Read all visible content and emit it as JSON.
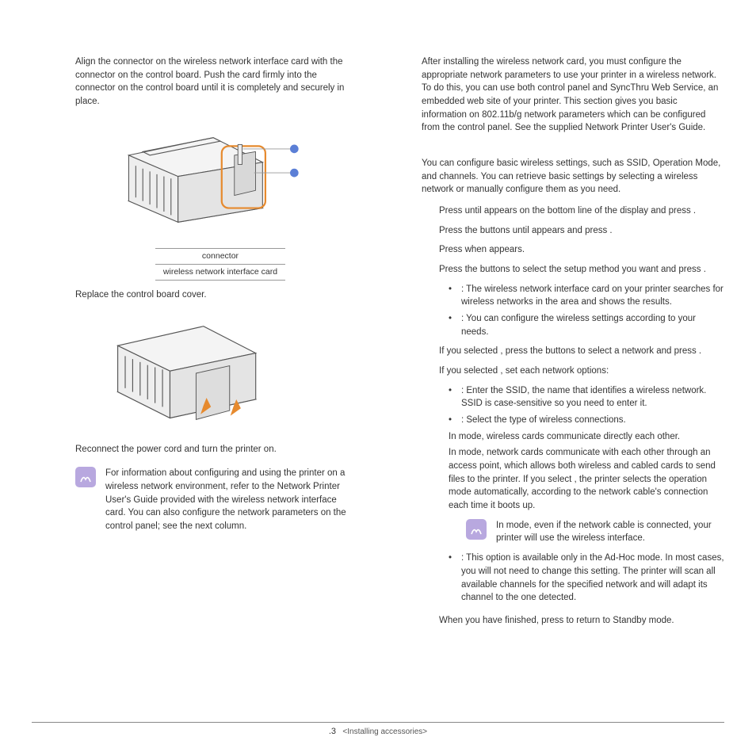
{
  "left": {
    "p1": "Align the connector on the wireless network interface card with the connector on the control board. Push the card firmly into the connector on the control board until it is completely and securely in place.",
    "callout1": "connector",
    "callout2": "wireless network interface card",
    "p2": "Replace the control board cover.",
    "p3": "Reconnect the power cord and turn the printer on.",
    "note": "For information about configuring and using the printer on a wireless network environment, refer to the Network Printer User's Guide provided with the wireless network interface card. You can also configure the network parameters on the control panel; see the next column."
  },
  "right": {
    "intro": "After installing the wireless network card, you must configure the appropriate network parameters to use your printer in a wireless network. To do this, you can use both control panel and SyncThru Web Service, an embedded web site of your printer. This section gives you basic information on 802.11b/g network parameters which can be configured from the control panel. See the supplied Network Printer User's Guide.",
    "p2": "You can configure basic wireless settings, such as SSID, Operation Mode, and channels. You can retrieve basic settings by selecting a wireless network or manually configure them as you need.",
    "s1": "Press           until                  appears on the bottom line of the display and press       .",
    "s2": "Press the           buttons until                  appears and press       .",
    "s3": "Press        when                  appears.",
    "s4": "Press the           buttons to select the setup method you want and press       .",
    "s4b1": "                : The wireless network interface card on your printer searches for wireless networks in the area and shows the results.",
    "s4b2": "              : You can configure the wireless settings according to your needs.",
    "s5": "If you selected                  , press the           buttons to select a network and press       .",
    "s6": "If you selected              , set each network options:",
    "s6b1": "              : Enter the SSID, the name that identifies a wireless network. SSID is case-sensitive so you need to enter it.",
    "s6b2": "                        : Select the type of wireless connections.",
    "s6b2a": "In                mode, wireless cards communicate directly each other.",
    "s6b2b": "In                        mode, network cards communicate with each other through an access point, which allows both wireless and cabled cards to send files to the printer. If you select             , the printer selects the operation mode automatically, according to the network cable's connection each time it boots up.",
    "rnote": "In                mode, even if the network cable is connected, your printer will use the wireless interface.",
    "s6b3": "              : This option is available only in the Ad-Hoc mode. In most cases, you will not need to change this setting. The printer will scan all available channels for the specified network and will adapt its channel to the one detected.",
    "s7": "When you have finished, press          to return to Standby mode."
  },
  "footer": {
    "page": ".3",
    "section": "<Installing accessories>"
  }
}
